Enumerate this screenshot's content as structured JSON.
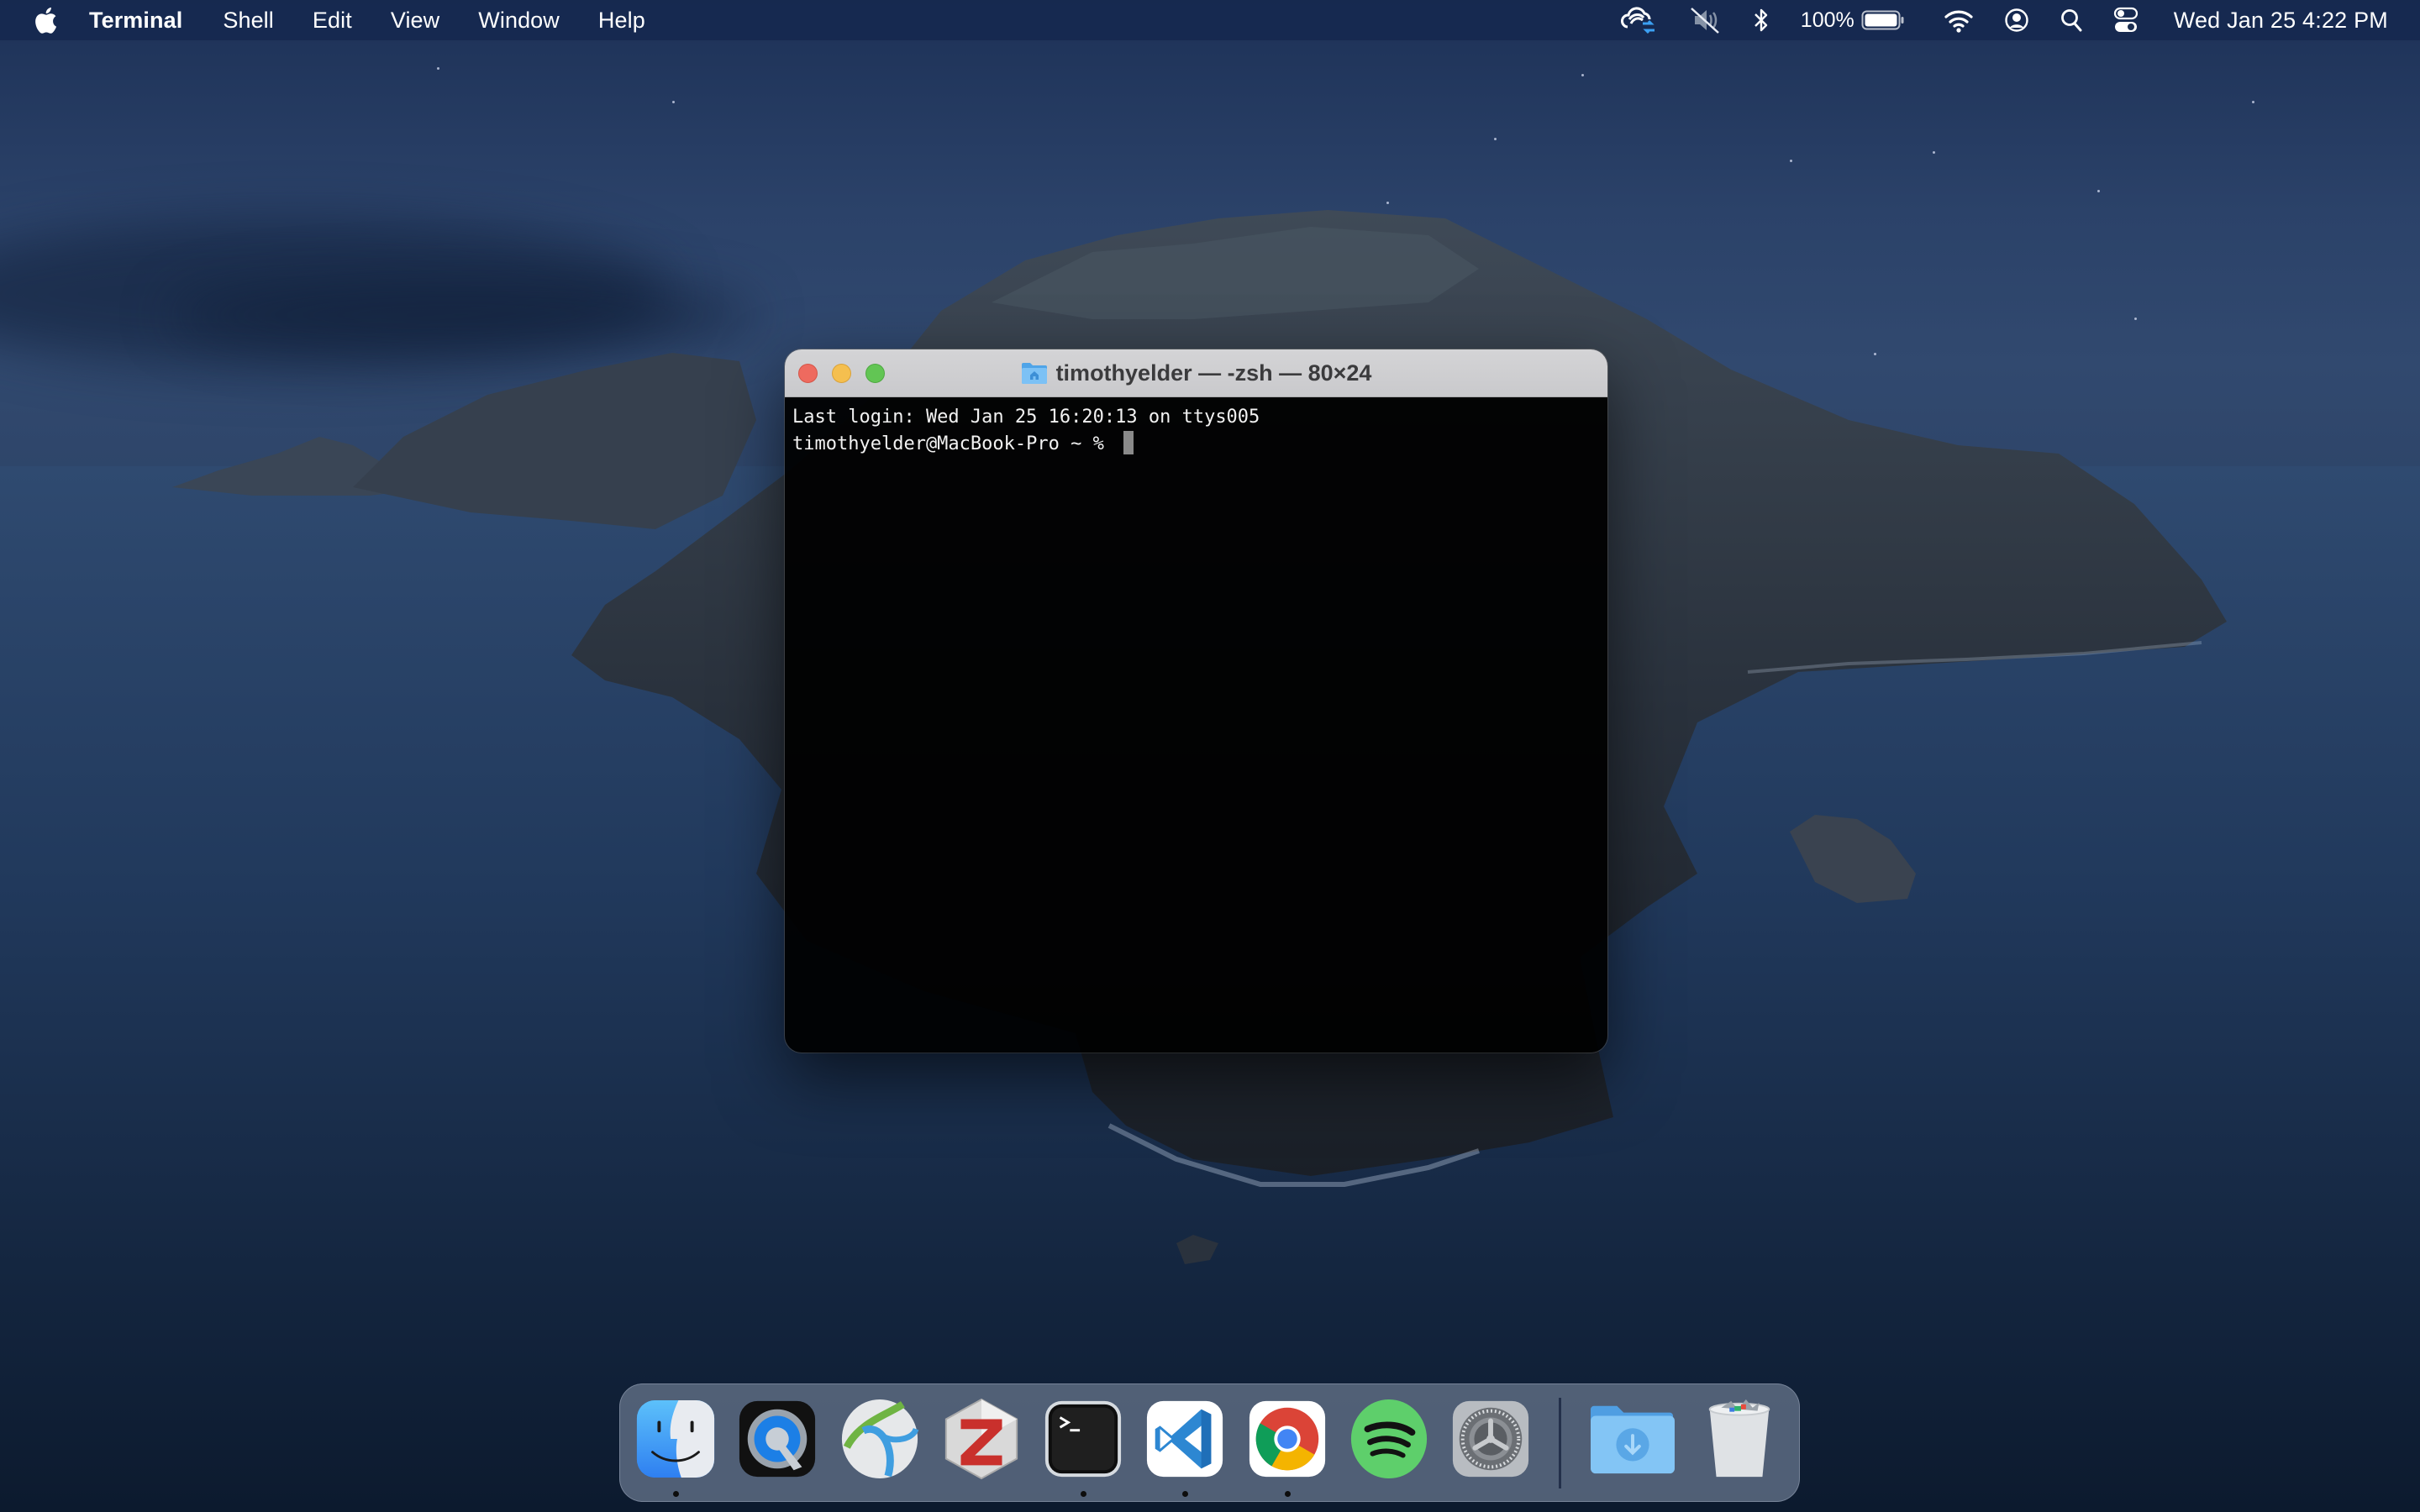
{
  "menubar": {
    "apple_icon": "apple-logo-icon",
    "app_name": "Terminal",
    "menus": [
      "Shell",
      "Edit",
      "View",
      "Window",
      "Help"
    ],
    "status_items": [
      {
        "name": "creative-cloud-sync-icon"
      },
      {
        "name": "volume-muted-icon"
      },
      {
        "name": "bluetooth-icon"
      },
      {
        "name": "battery-icon",
        "label": "100%",
        "level": 1.0
      },
      {
        "name": "wifi-icon"
      },
      {
        "name": "user-account-icon"
      },
      {
        "name": "spotlight-search-icon"
      },
      {
        "name": "control-center-icon"
      }
    ],
    "battery_label": "100%",
    "clock": "Wed Jan 25  4:22 PM"
  },
  "window": {
    "title": "timothyelder — -zsh — 80×24",
    "title_icon": "home-folder-icon",
    "buttons": [
      "close",
      "minimize",
      "zoom"
    ],
    "terminal": {
      "lines": [
        "Last login: Wed Jan 25 16:20:13 on ttys005",
        "timothyelder@MacBook-Pro ~ % "
      ]
    }
  },
  "dock": {
    "apps": [
      {
        "name": "Finder",
        "icon": "finder-icon",
        "running": true
      },
      {
        "name": "QuickTime Player",
        "icon": "quicktime-icon",
        "running": false
      },
      {
        "name": "Cisco AnyConnect",
        "icon": "anyconnect-icon",
        "running": false
      },
      {
        "name": "Zotero",
        "icon": "zotero-icon",
        "running": false
      },
      {
        "name": "Terminal",
        "icon": "terminal-icon",
        "running": true
      },
      {
        "name": "Visual Studio Code",
        "icon": "vscode-icon",
        "running": true
      },
      {
        "name": "Google Chrome",
        "icon": "chrome-icon",
        "running": true
      },
      {
        "name": "Spotify",
        "icon": "spotify-icon",
        "running": false
      },
      {
        "name": "System Preferences",
        "icon": "system-preferences-icon",
        "running": false
      }
    ],
    "others": [
      {
        "name": "Downloads",
        "icon": "downloads-folder-icon"
      },
      {
        "name": "Trash",
        "icon": "trash-icon"
      }
    ]
  }
}
